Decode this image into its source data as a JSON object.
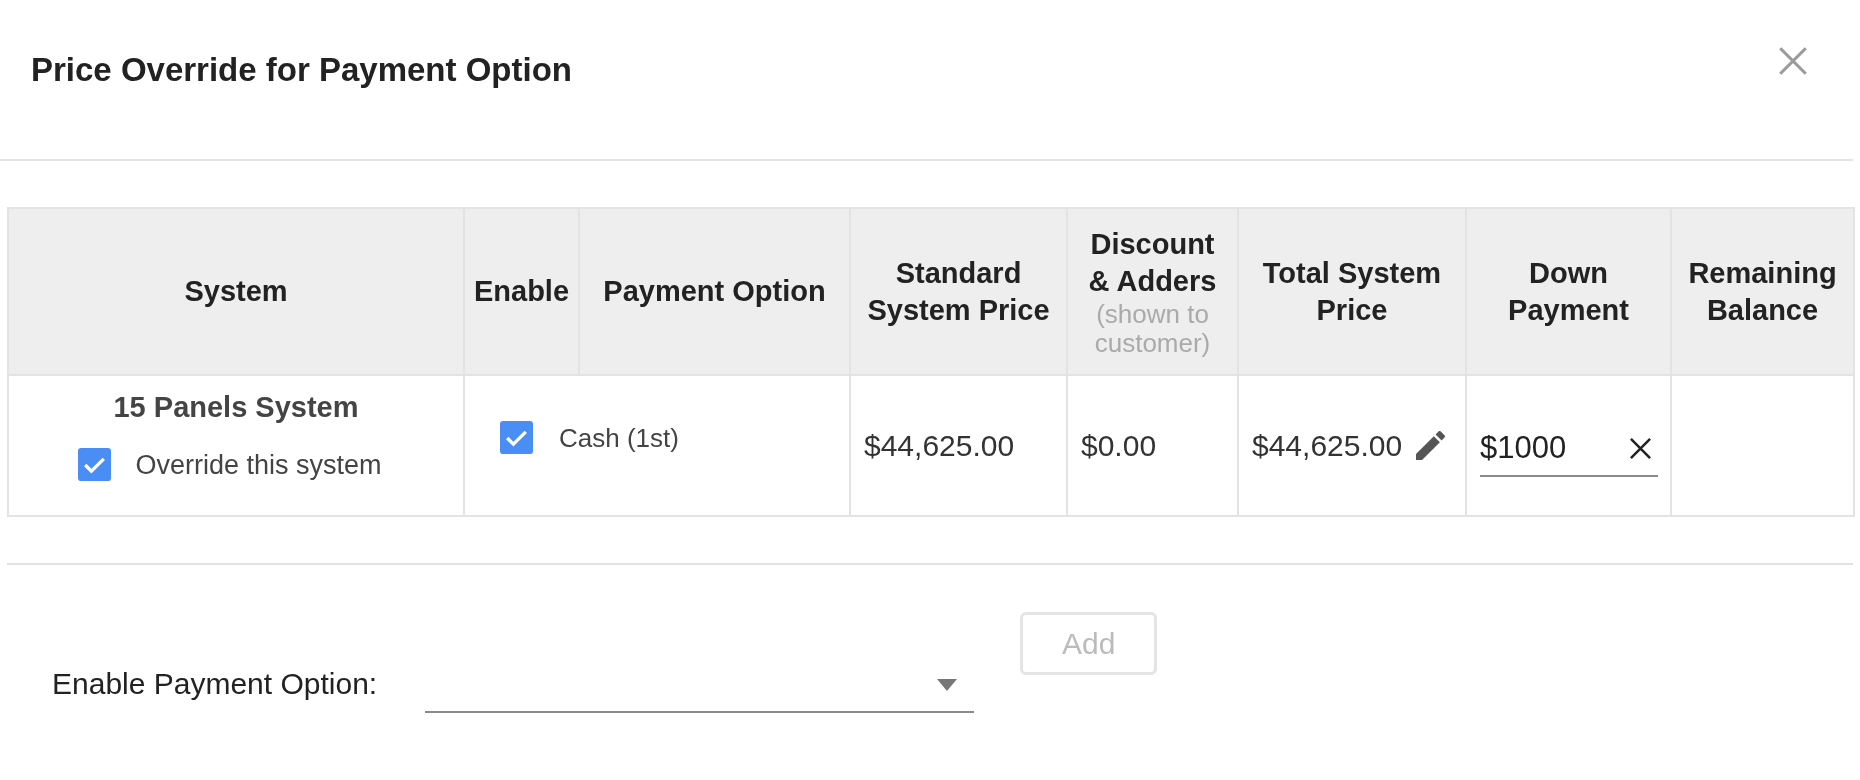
{
  "dialog": {
    "title": "Price Override for Payment Option"
  },
  "table": {
    "columns": [
      {
        "label": "System"
      },
      {
        "label": "Enable"
      },
      {
        "label": "Payment Option"
      },
      {
        "label": "Standard System Price"
      },
      {
        "label": "Discount & Adders",
        "note": "(shown to customer)"
      },
      {
        "label": "Total System Price"
      },
      {
        "label": "Down Payment"
      },
      {
        "label": "Remaining Balance"
      }
    ],
    "rows": [
      {
        "system": "15 Panels System",
        "override": {
          "label": "Override this system",
          "checked": true
        },
        "payment_option": {
          "label": "Cash (1st)",
          "checked": true
        },
        "standard_price": "$44,625.00",
        "discount": "$0.00",
        "total_price": "$44,625.00",
        "down_payment": "$1000"
      }
    ]
  },
  "footer": {
    "label": "Enable Payment Option:",
    "add_button": {
      "label": "Add",
      "disabled": true
    }
  }
}
